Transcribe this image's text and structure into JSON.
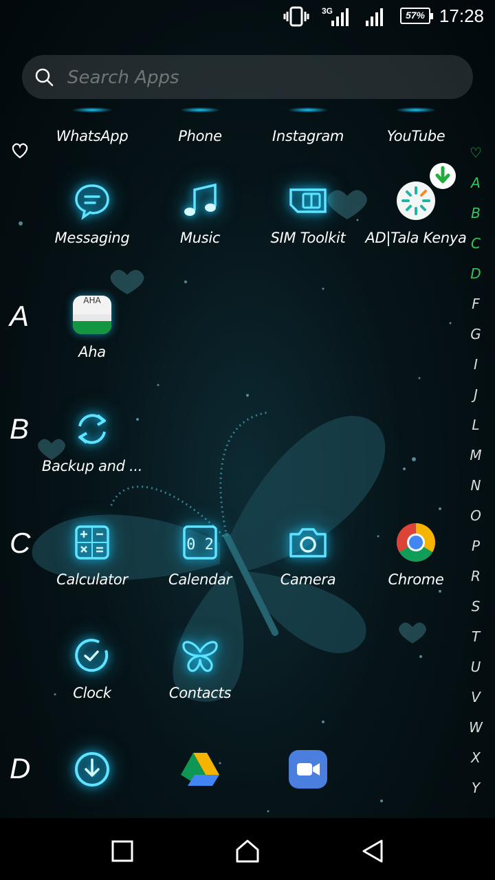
{
  "status_bar": {
    "time": "17:28",
    "battery": "57%",
    "network": "3G"
  },
  "search": {
    "placeholder": "Search Apps"
  },
  "sections": {
    "fav_symbol": "♡",
    "a": "A",
    "b": "B",
    "c": "C",
    "d": "D"
  },
  "apps": {
    "whatsapp": "WhatsApp",
    "phone": "Phone",
    "instagram": "Instagram",
    "youtube": "YouTube",
    "messaging": "Messaging",
    "music": "Music",
    "sim_toolkit": "SIM Toolkit",
    "tala": "AD|Tala Kenya",
    "aha": "Aha",
    "aha_icon_text": "AHA",
    "backup": "Backup and ...",
    "calculator": "Calculator",
    "calendar": "Calendar",
    "calendar_icon_text": "0 2",
    "camera": "Camera",
    "chrome": "Chrome",
    "clock": "Clock",
    "contacts": "Contacts"
  },
  "alphabet": [
    "♡",
    "A",
    "B",
    "C",
    "D",
    "F",
    "G",
    "I",
    "J",
    "L",
    "M",
    "N",
    "O",
    "P",
    "R",
    "S",
    "T",
    "U",
    "V",
    "W",
    "X",
    "Y"
  ],
  "colors": {
    "glow": "#19c9ff",
    "accent_green": "#33c75a"
  },
  "nav": {
    "recents": "recents-icon",
    "home": "home-icon",
    "back": "back-icon"
  }
}
